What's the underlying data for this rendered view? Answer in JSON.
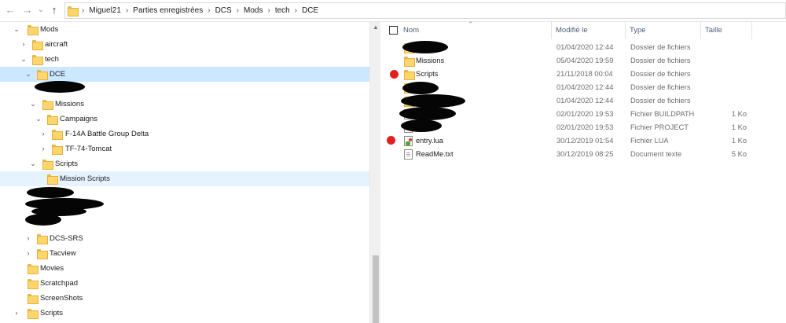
{
  "nav": {
    "back": "←",
    "forward": "→",
    "recent": "⌄",
    "up": "↑"
  },
  "breadcrumb": [
    "Miguel21",
    "Parties enregistrées",
    "DCS",
    "Mods",
    "tech",
    "DCE"
  ],
  "tree": {
    "items": [
      {
        "label": "Mods"
      },
      {
        "label": "aircraft"
      },
      {
        "label": "tech"
      },
      {
        "label": "DCE"
      },
      {
        "label": "Missions"
      },
      {
        "label": "Campaigns"
      },
      {
        "label": "F-14A Battle Group Delta"
      },
      {
        "label": "TF-74-Tomcat"
      },
      {
        "label": "Scripts"
      },
      {
        "label": "Mission Scripts"
      },
      {
        "label": "DCS-SRS"
      },
      {
        "label": "Tacview"
      },
      {
        "label": "Movies"
      },
      {
        "label": "Scratchpad"
      },
      {
        "label": "ScreenShots"
      },
      {
        "label": "Scripts"
      }
    ]
  },
  "columns": {
    "name": "Nom",
    "modified": "Modifié le",
    "type": "Type",
    "size": "Taille"
  },
  "files": [
    {
      "name": "",
      "date": "01/04/2020 12:44",
      "type": "Dossier de fichiers",
      "size": ""
    },
    {
      "name": "Missions",
      "date": "05/04/2020 19:59",
      "type": "Dossier de fichiers",
      "size": ""
    },
    {
      "name": "Scripts",
      "date": "21/11/2018 00:04",
      "type": "Dossier de fichiers",
      "size": ""
    },
    {
      "name": "",
      "date": "01/04/2020 12:44",
      "type": "Dossier de fichiers",
      "size": ""
    },
    {
      "name": "",
      "date": "01/04/2020 12:44",
      "type": "Dossier de fichiers",
      "size": ""
    },
    {
      "name": "",
      "date": "02/01/2020 19:53",
      "type": "Fichier BUILDPATH",
      "size": "1 Ko"
    },
    {
      "name": "",
      "date": "02/01/2020 19:53",
      "type": "Fichier PROJECT",
      "size": "1 Ko"
    },
    {
      "name": "entry.lua",
      "date": "30/12/2019 01:54",
      "type": "Fichier LUA",
      "size": "1 Ko"
    },
    {
      "name": "ReadMe.txt",
      "date": "30/12/2019 08:25",
      "type": "Document texte",
      "size": "5 Ko"
    }
  ],
  "colors": {
    "selection": "#cce8ff",
    "hover": "#e5f3ff",
    "folder": "#ffd66b",
    "marker": "#e41e1e",
    "header_text": "#4c607a"
  }
}
